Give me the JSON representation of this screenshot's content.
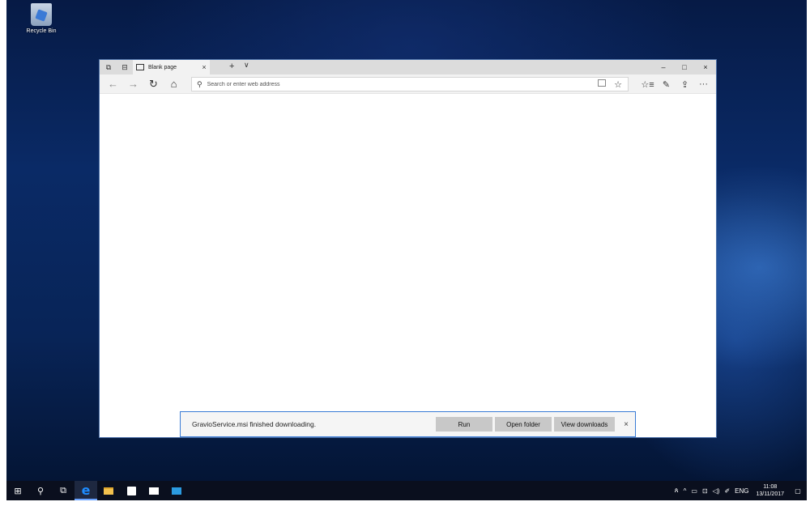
{
  "desktop": {
    "recycle_bin_label": "Recycle Bin"
  },
  "browser": {
    "tab_title": "Blank page",
    "tab_close": "×",
    "new_tab": "+",
    "tab_menu": "∨",
    "minimize": "–",
    "maximize": "□",
    "close": "×",
    "address_placeholder": "Search or enter web address",
    "icons": {
      "set_aside_tabs": "⧉",
      "show_tabs": "⊟",
      "back": "←",
      "forward": "→",
      "refresh": "↻",
      "home": "⌂",
      "search": "⚲",
      "favorite": "☆",
      "hub": "☆≡",
      "notes": "✎",
      "share": "⇪",
      "more": "···"
    }
  },
  "download_bar": {
    "message": "GravioService.msi finished downloading.",
    "run_label": "Run",
    "open_folder_label": "Open folder",
    "view_downloads_label": "View downloads",
    "close": "×"
  },
  "taskbar": {
    "icons": {
      "start": "⊞",
      "search": "⚲",
      "task_view": "⧉",
      "edge": "e",
      "people": "ጰ",
      "chevron_up": "^",
      "battery": "▭",
      "network": "⊡",
      "volume": "◁)",
      "pen": "✐",
      "notification": "▢"
    },
    "language": "ENG",
    "time": "11:08",
    "date": "13/11/2017"
  }
}
